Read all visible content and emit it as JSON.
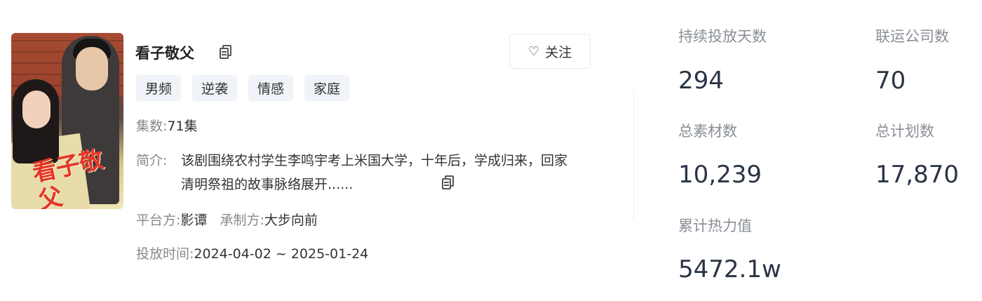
{
  "drama": {
    "title": "看子敬父",
    "poster_text": "看子敬父",
    "follow_label": "关注",
    "follow_icon": "heart-outline",
    "tags": [
      "男频",
      "逆袭",
      "情感",
      "家庭"
    ],
    "episodes_label": "集数:",
    "episodes_value": "71集",
    "synopsis_label": "简介:",
    "synopsis_text": "该剧围绕农村学生李鸣宇考上米国大学，十年后，学成归来，回家清明祭祖的故事脉络展开......",
    "platform_label": "平台方:",
    "platform_value": "影谭",
    "producer_label": "承制方:",
    "producer_value": "大步向前",
    "period_label": "投放时间:",
    "period_value": "2024-04-02 ~ 2025-01-24"
  },
  "stats": {
    "days_label": "持续投放天数",
    "days_value": "294",
    "companies_label": "联运公司数",
    "companies_value": "70",
    "materials_label": "总素材数",
    "materials_value": "10,239",
    "plans_label": "总计划数",
    "plans_value": "17,870",
    "heat_label": "累计热力值",
    "heat_value": "5472.1w"
  },
  "colors": {
    "label_gray": "#888888",
    "stat_value": "#2a3444",
    "tag_bg": "#f0f3f8"
  }
}
